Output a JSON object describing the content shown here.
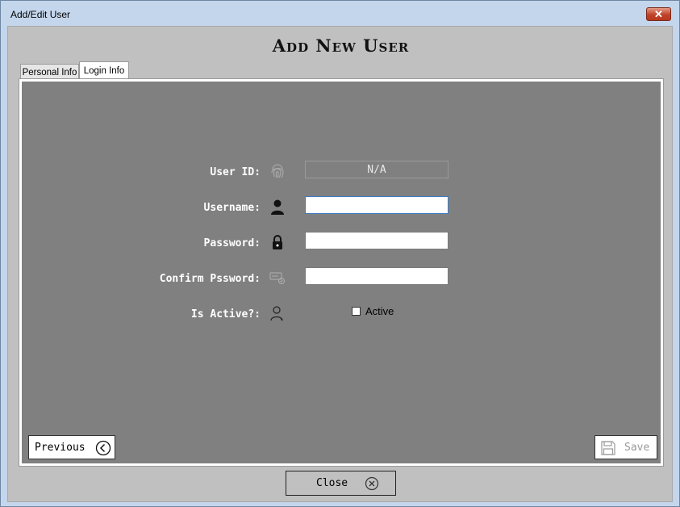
{
  "window": {
    "title": "Add/Edit User",
    "close_glyph": "✕"
  },
  "heading": "Add New User",
  "tabs": [
    {
      "label": "Personal Info",
      "active": false
    },
    {
      "label": "Login Info",
      "active": true
    }
  ],
  "form": {
    "user_id": {
      "label": "User ID:",
      "value": "N/A",
      "icon": "fingerprint-icon"
    },
    "username": {
      "label": "Username:",
      "value": "",
      "icon": "user-icon"
    },
    "password": {
      "label": "Password:",
      "value": "",
      "icon": "lock-icon"
    },
    "confirm_password": {
      "label": "Confirm Pssword:",
      "value": "",
      "icon": "key-card-icon"
    },
    "is_active": {
      "label": "Is Active?:",
      "icon": "person-outline-icon",
      "checkbox_label": "Active",
      "checked": false
    }
  },
  "buttons": {
    "previous": {
      "label": "Previous",
      "icon": "chevron-left-circle-icon"
    },
    "save": {
      "label": "Save",
      "icon": "floppy-disk-icon",
      "enabled": false
    },
    "close": {
      "label": "Close",
      "icon": "close-circle-icon"
    }
  },
  "colors": {
    "panel": "#808080",
    "client": "#c0c0c0",
    "titlebar": "#c4d6ec",
    "close_button": "#c0432a"
  }
}
